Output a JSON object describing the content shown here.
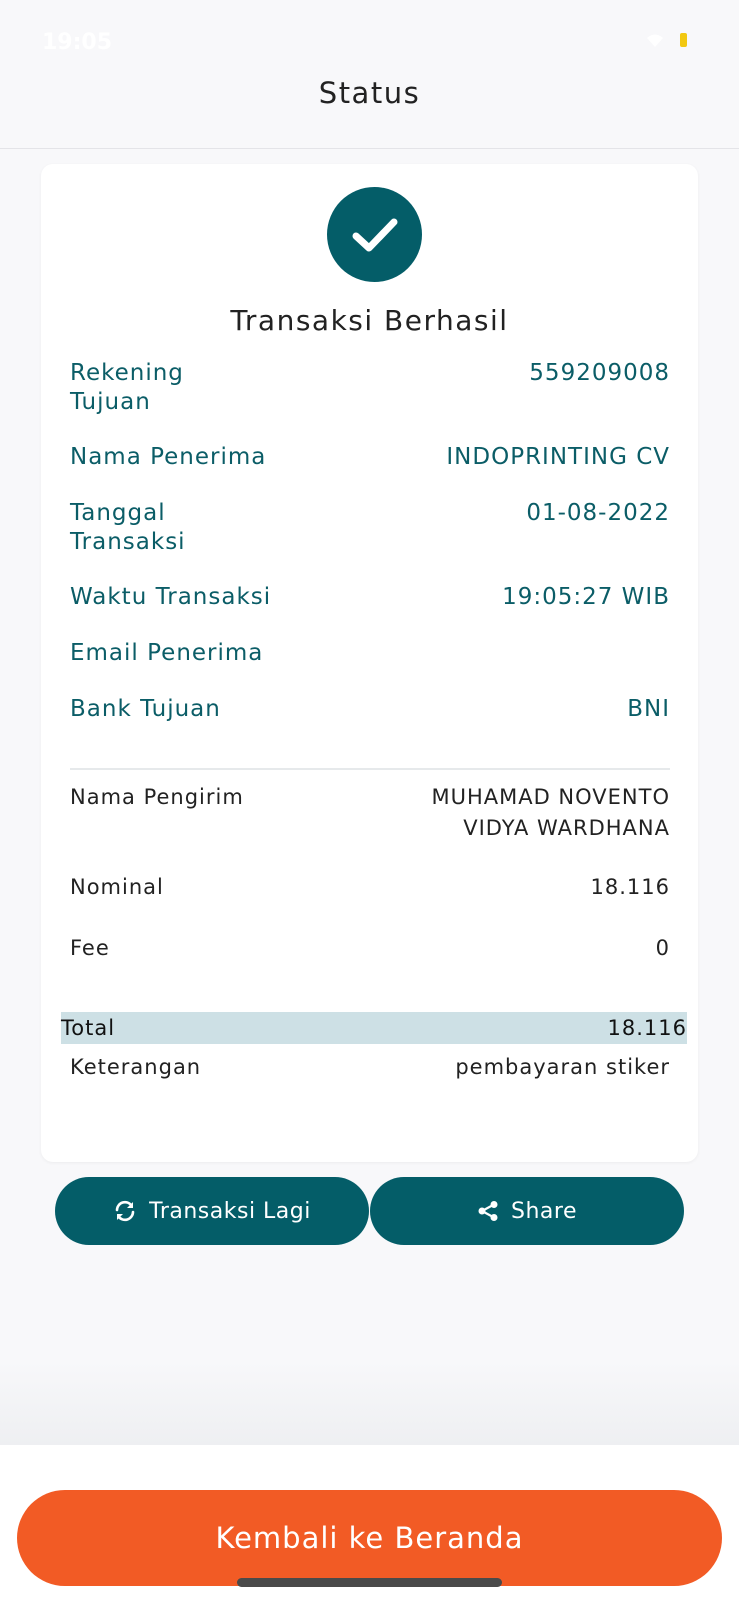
{
  "status_bar": {
    "time": "19:05"
  },
  "header": {
    "title": "Status"
  },
  "card": {
    "title": "Transaksi Berhasil",
    "details": [
      {
        "label": "Rekening Tujuan",
        "value": "559209008"
      },
      {
        "label": "Nama Penerima",
        "value": "INDOPRINTING CV"
      },
      {
        "label": "Tanggal Transaksi",
        "value": "01-08-2022"
      },
      {
        "label": "Waktu Transaksi",
        "value": "19:05:27 WIB"
      },
      {
        "label": "Email Penerima",
        "value": ""
      },
      {
        "label": "Bank Tujuan",
        "value": "BNI"
      }
    ],
    "sender": {
      "label": "Nama Pengirim",
      "value_line1": "MUHAMAD NOVENTO",
      "value_line2": "VIDYA WARDHANA"
    },
    "nominal": {
      "label": "Nominal",
      "value": "18.116"
    },
    "fee": {
      "label": "Fee",
      "value": "0"
    },
    "total": {
      "label": "Total",
      "value": "18.116"
    },
    "keterangan": {
      "label": "Keterangan",
      "value": "pembayaran stiker"
    }
  },
  "actions": {
    "repeat_label": "Transaksi Lagi",
    "share_label": "Share"
  },
  "footer": {
    "home_label": "Kembali ke Beranda"
  },
  "colors": {
    "primary": "#045d68",
    "accent": "#f25b25",
    "total_highlight": "#cde0e5"
  },
  "icons": {
    "success": "check-icon",
    "repeat": "refresh-icon",
    "share": "share-icon"
  }
}
